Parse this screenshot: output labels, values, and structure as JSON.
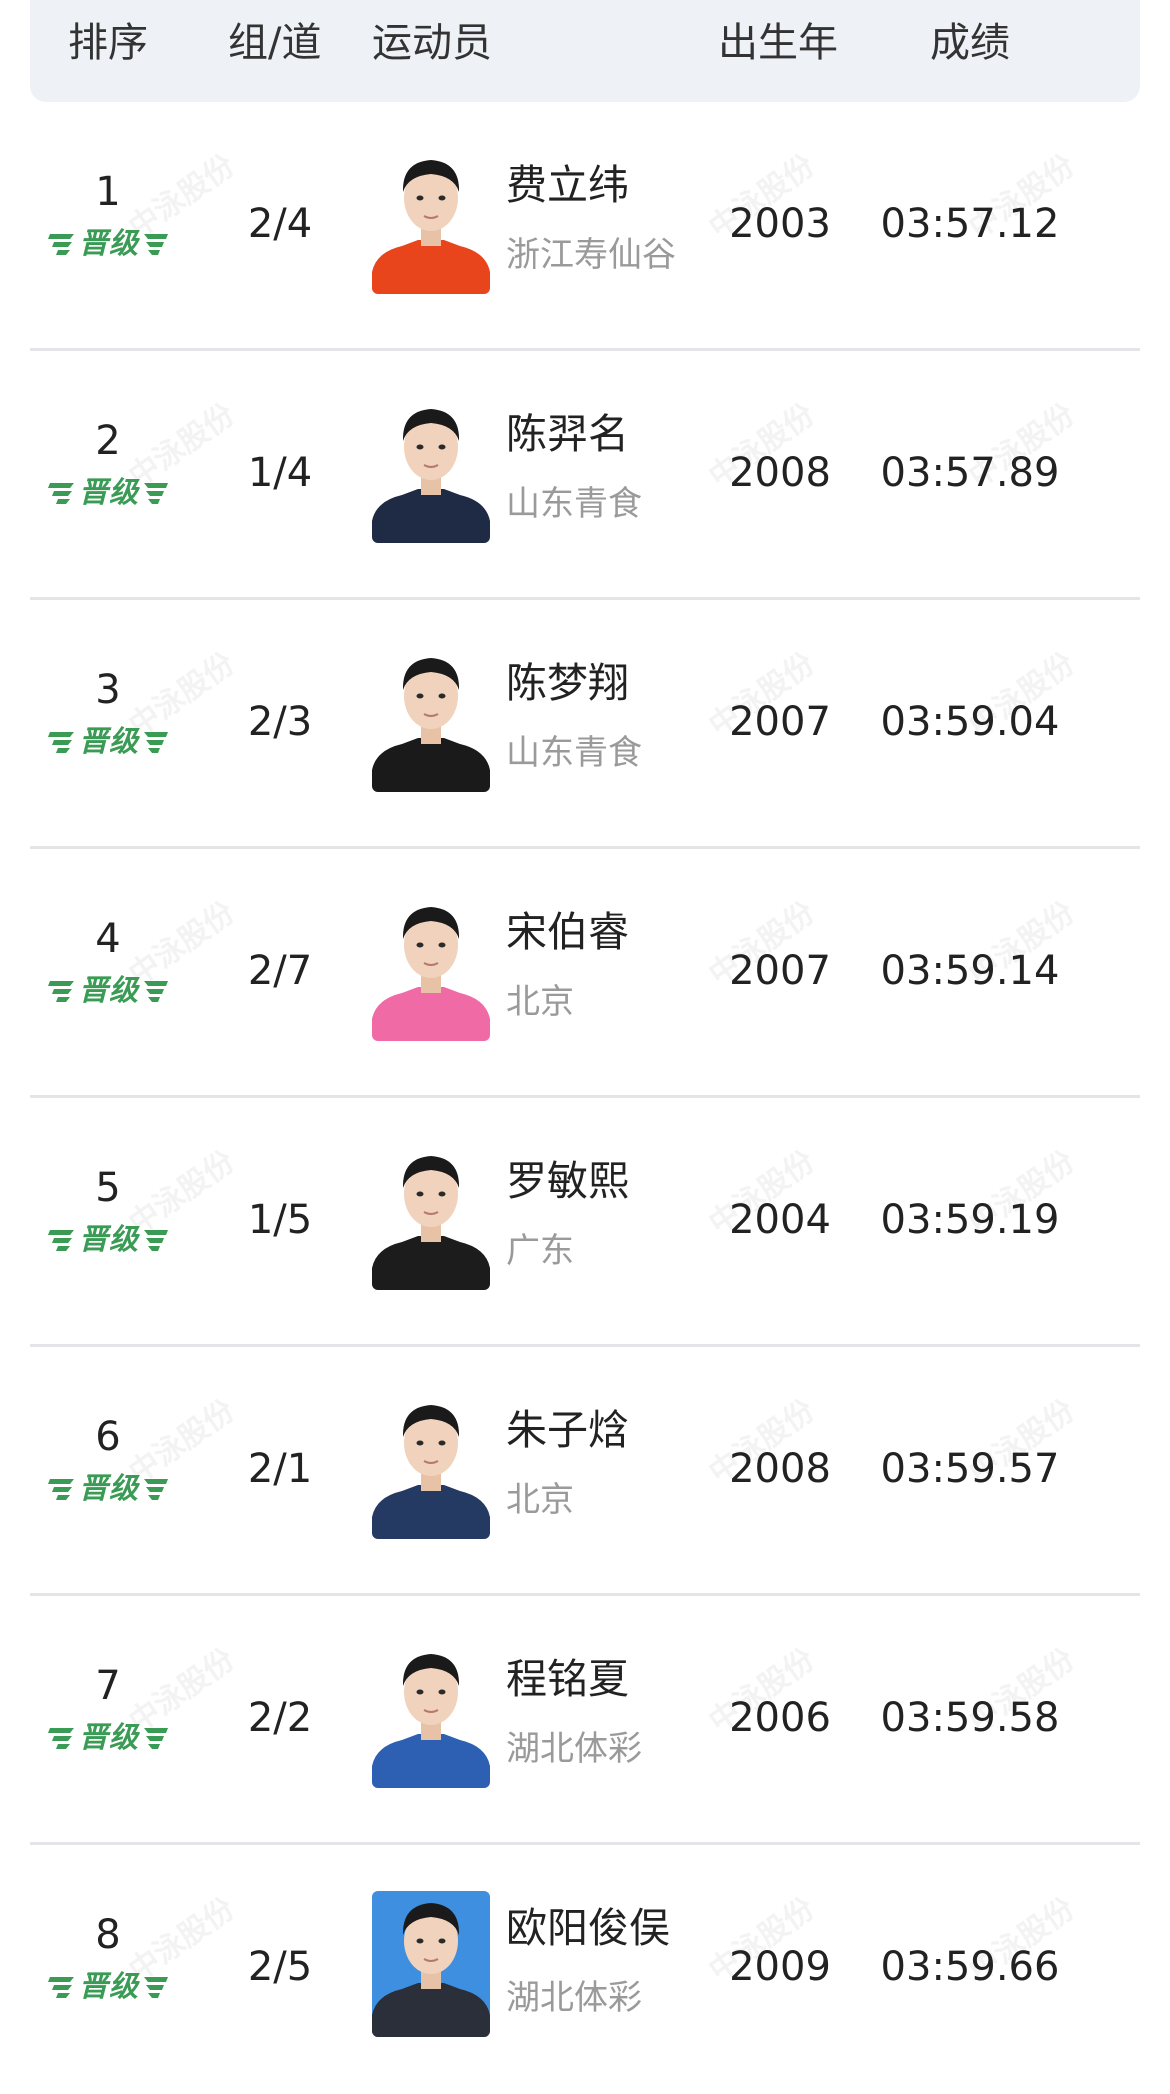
{
  "header": {
    "rank": "排序",
    "lane": "组/道",
    "athlete": "运动员",
    "birth_year": "出生年",
    "result": "成绩"
  },
  "badge_label": "晋级",
  "watermark": "中泳股份",
  "colors": {
    "header_bg": "#eef1f6",
    "badge_green": "#3a9b55",
    "team_gray": "#9a9a9a",
    "divider": "#e3e5e8"
  },
  "rows": [
    {
      "rank": "1",
      "lane": "2/4",
      "name": "费立纬",
      "team": "浙江寿仙谷",
      "birth_year": "2003",
      "result": "03:57.12",
      "photo_bg": "#ffffff",
      "shirt": "#e8451c"
    },
    {
      "rank": "2",
      "lane": "1/4",
      "name": "陈羿名",
      "team": "山东青食",
      "birth_year": "2008",
      "result": "03:57.89",
      "photo_bg": "#ffffff",
      "shirt": "#1f2a44"
    },
    {
      "rank": "3",
      "lane": "2/3",
      "name": "陈梦翔",
      "team": "山东青食",
      "birth_year": "2007",
      "result": "03:59.04",
      "photo_bg": "#ffffff",
      "shirt": "#1a1a1a"
    },
    {
      "rank": "4",
      "lane": "2/7",
      "name": "宋伯睿",
      "team": "北京",
      "birth_year": "2007",
      "result": "03:59.14",
      "photo_bg": "#ffffff",
      "shirt": "#f06aa5"
    },
    {
      "rank": "5",
      "lane": "1/5",
      "name": "罗敏熙",
      "team": "广东",
      "birth_year": "2004",
      "result": "03:59.19",
      "photo_bg": "#ffffff",
      "shirt": "#1c1c1c"
    },
    {
      "rank": "6",
      "lane": "2/1",
      "name": "朱子焓",
      "team": "北京",
      "birth_year": "2008",
      "result": "03:59.57",
      "photo_bg": "#ffffff",
      "shirt": "#243a63"
    },
    {
      "rank": "7",
      "lane": "2/2",
      "name": "程铭夏",
      "team": "湖北体彩",
      "birth_year": "2006",
      "result": "03:59.58",
      "photo_bg": "#ffffff",
      "shirt": "#2d5fb3"
    },
    {
      "rank": "8",
      "lane": "2/5",
      "name": "欧阳俊俣",
      "team": "湖北体彩",
      "birth_year": "2009",
      "result": "03:59.66",
      "photo_bg": "#3f8fe0",
      "shirt": "#2a2f3a"
    }
  ]
}
